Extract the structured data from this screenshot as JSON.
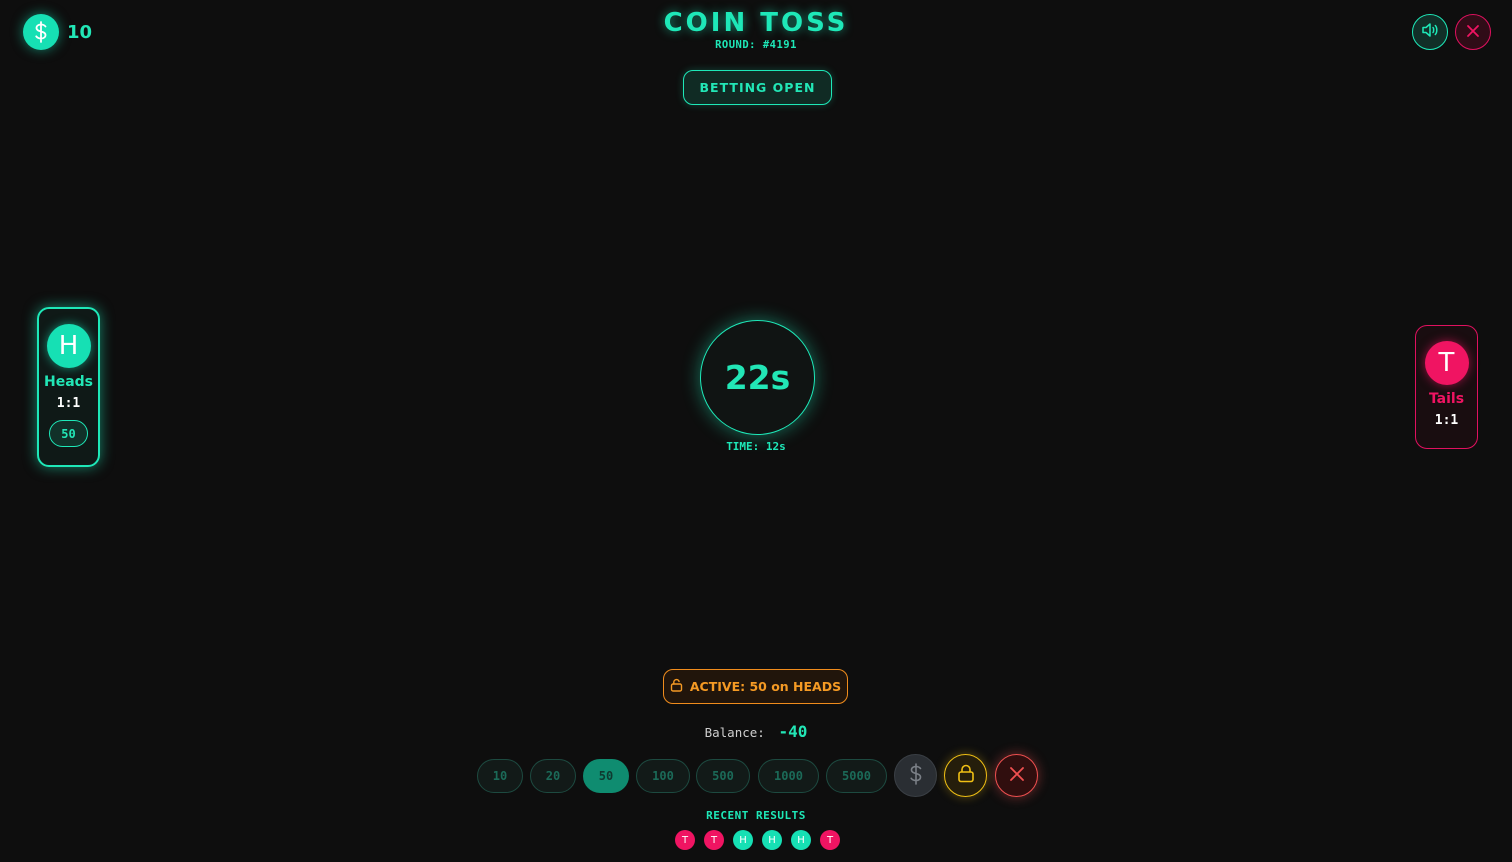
{
  "wallet": {
    "icon": "dollar-icon",
    "amount": "10"
  },
  "header": {
    "title": "COIN TOSS",
    "round": "ROUND: #4191",
    "status": "BETTING OPEN"
  },
  "controls": {
    "sound_icon": "speaker-icon",
    "close_icon": "close-icon"
  },
  "heads": {
    "letter": "H",
    "name": "Heads",
    "odds": "1:1",
    "bet": "50"
  },
  "tails": {
    "letter": "T",
    "name": "Tails",
    "odds": "1:1"
  },
  "timer": {
    "value": "22s",
    "sub": "TIME: 12s"
  },
  "active_bet": {
    "icon": "lock-open-icon",
    "text": "ACTIVE: 50 on HEADS"
  },
  "balance": {
    "label": "Balance:",
    "value": "-40"
  },
  "chips": [
    "10",
    "20",
    "50",
    "100",
    "500",
    "1000",
    "5000"
  ],
  "selected_chip": "50",
  "actions": {
    "custom_icon": "dollar-icon",
    "lock_icon": "lock-icon",
    "cancel_icon": "close-icon"
  },
  "recent": {
    "title": "RECENT RESULTS",
    "results": [
      "T",
      "T",
      "H",
      "H",
      "H",
      "T"
    ]
  },
  "colors": {
    "accent": "#1ee8b8",
    "tails": "#f01462",
    "active": "#f59a24",
    "lock": "#f0c014",
    "cancel": "#f05050"
  }
}
